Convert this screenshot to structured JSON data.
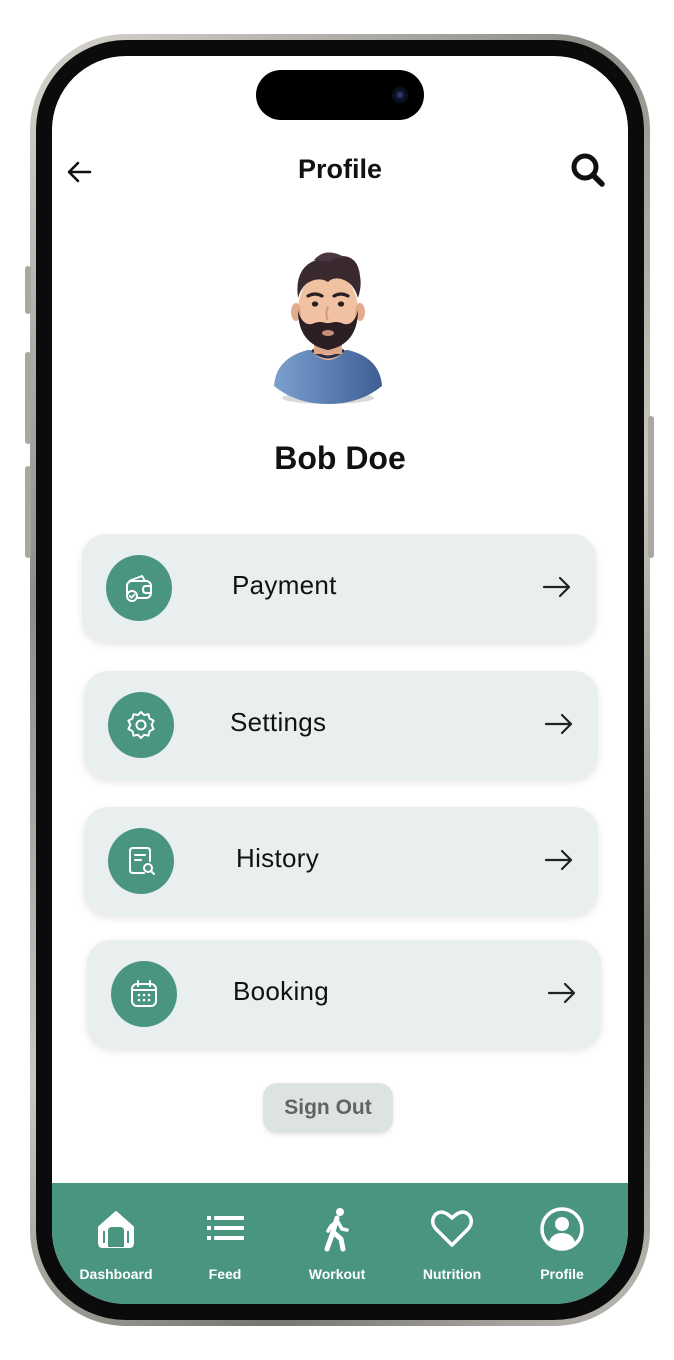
{
  "header": {
    "title": "Profile",
    "back_icon": "arrow-left-icon",
    "search_icon": "search-icon"
  },
  "profile": {
    "name": "Bob Doe",
    "avatar": "bearded-man-avatar"
  },
  "menu": [
    {
      "label": "Payment",
      "icon": "wallet-check-icon"
    },
    {
      "label": "Settings",
      "icon": "gear-icon"
    },
    {
      "label": "History",
      "icon": "receipt-search-icon"
    },
    {
      "label": "Booking",
      "icon": "calendar-icon"
    }
  ],
  "sign_out": {
    "label": "Sign Out"
  },
  "bottom_nav": [
    {
      "label": "Dashboard",
      "icon": "home-icon"
    },
    {
      "label": "Feed",
      "icon": "list-icon"
    },
    {
      "label": "Workout",
      "icon": "walking-icon"
    },
    {
      "label": "Nutrition",
      "icon": "heart-icon"
    },
    {
      "label": "Profile",
      "icon": "user-circle-icon"
    }
  ],
  "colors": {
    "accent": "#4a9580",
    "card_bg": "#e9efee",
    "signout_bg": "#dde3e2"
  }
}
